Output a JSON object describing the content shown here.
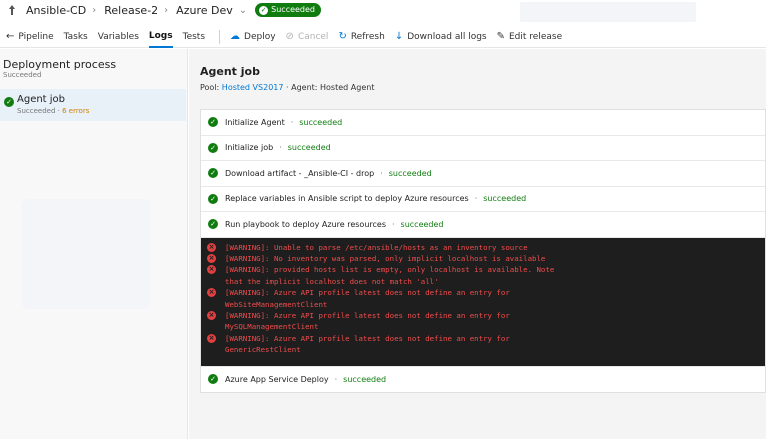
{
  "breadcrumb": {
    "project": "Ansible-CD",
    "release": "Release-2",
    "environment": "Azure Dev",
    "status": "Succeeded"
  },
  "toolbar": {
    "items": [
      "Pipeline",
      "Tasks",
      "Variables",
      "Logs",
      "Tests"
    ],
    "active": "Logs",
    "deploy": "Deploy",
    "cancel": "Cancel",
    "refresh": "Refresh",
    "download": "Download all logs",
    "edit": "Edit release"
  },
  "left": {
    "process_title": "Deployment process",
    "process_status": "Succeeded",
    "job_name": "Agent job",
    "job_status": "Succeeded",
    "job_errors": "6 errors"
  },
  "main": {
    "title": "Agent job",
    "pool_label": "Pool:",
    "pool_name": "Hosted VS2017",
    "agent_text": "· Agent: Hosted Agent",
    "steps": [
      {
        "name": "Initialize Agent",
        "status": "succeeded"
      },
      {
        "name": "Initialize job",
        "status": "succeeded"
      },
      {
        "name": "Download artifact - _Ansible-CI - drop",
        "status": "succeeded"
      },
      {
        "name": "Replace variables in Ansible script to deploy Azure resources",
        "status": "succeeded"
      },
      {
        "name": "Run playbook to deploy Azure resources",
        "status": "succeeded"
      }
    ],
    "console_lines": [
      "[WARNING]: Unable to parse /etc/ansible/hosts as an inventory source",
      "[WARNING]: No inventory was parsed, only implicit localhost is available",
      "[WARNING]: provided hosts list is empty, only localhost is available. Note",
      "that the implicit localhost does not match 'all'",
      "[WARNING]: Azure API profile latest does not define an entry for",
      "WebSiteManagementClient",
      "[WARNING]: Azure API profile latest does not define an entry for",
      "MySQLManagementClient",
      "[WARNING]: Azure API profile latest does not define an entry for",
      "GenericRestClient"
    ],
    "last_step": {
      "name": "Azure App Service Deploy",
      "status": "succeeded"
    }
  },
  "colors": {
    "success": "#107c10",
    "accent": "#0078d4",
    "error": "#f14c4c",
    "console_bg": "#1e1e1e"
  }
}
